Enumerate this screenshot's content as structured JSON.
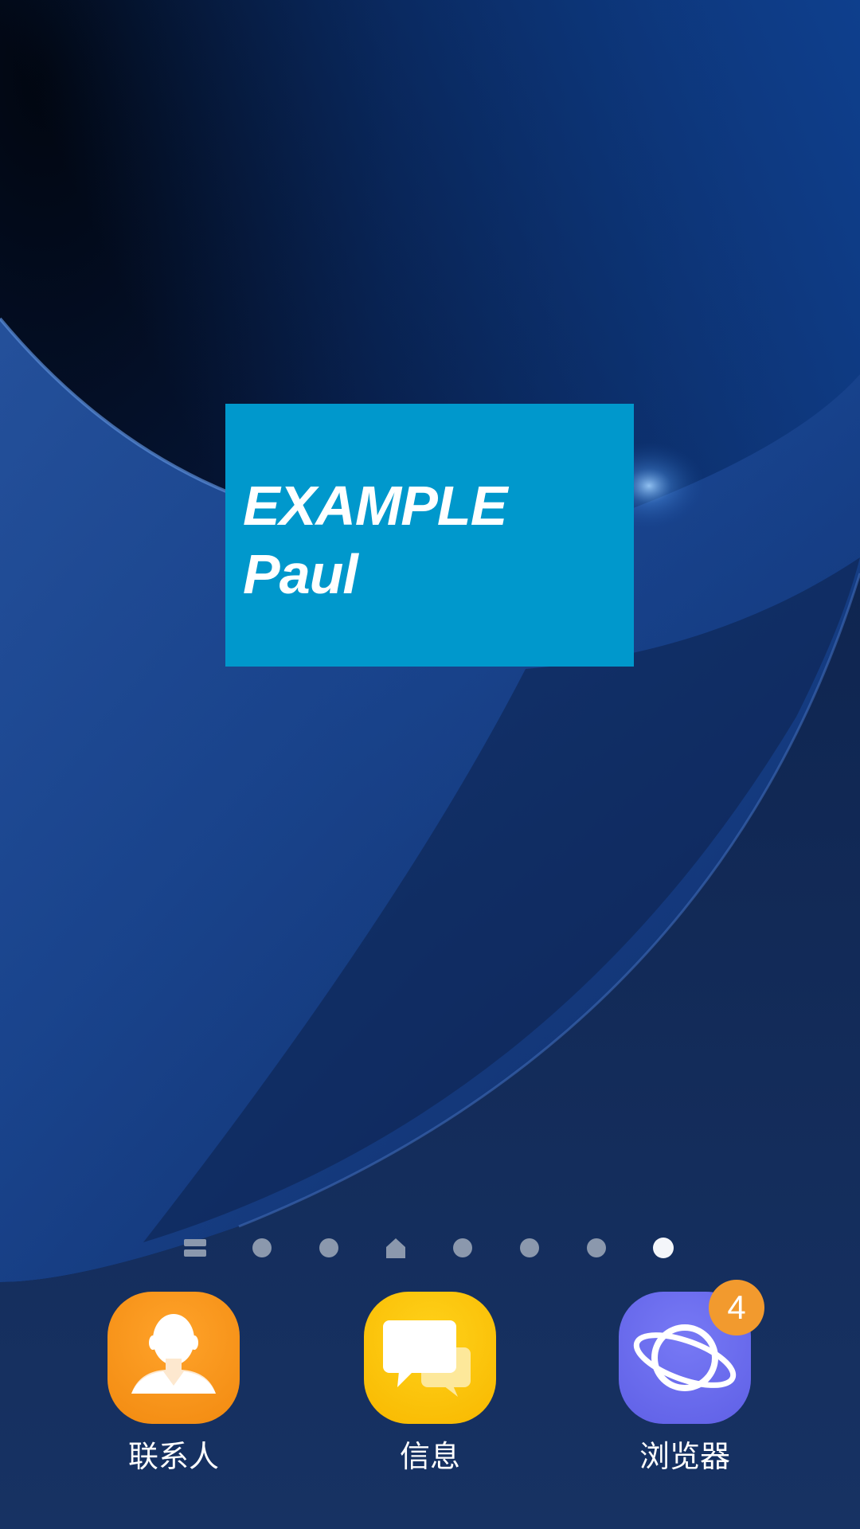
{
  "widget": {
    "line1": "EXAMPLE",
    "line2": "Paul",
    "background_color": "#0098cc"
  },
  "page_indicator": {
    "items": [
      {
        "type": "menu",
        "icon": "apps-list-icon"
      },
      {
        "type": "dot"
      },
      {
        "type": "dot"
      },
      {
        "type": "home",
        "icon": "home-icon"
      },
      {
        "type": "dot"
      },
      {
        "type": "dot"
      },
      {
        "type": "dot"
      },
      {
        "type": "dot",
        "active": true
      }
    ]
  },
  "dock": {
    "apps": [
      {
        "label": "联系人",
        "icon": "contacts-icon",
        "color": "#f7931a"
      },
      {
        "label": "信息",
        "icon": "messages-icon",
        "color": "#fcc400"
      },
      {
        "label": "浏览器",
        "icon": "browser-icon",
        "color": "#6b6cf0",
        "badge": "4"
      }
    ]
  },
  "colors": {
    "wallpaper_dark": "#020a1c",
    "wallpaper_blue": "#1b4fa0",
    "badge": "#f29a2e"
  }
}
